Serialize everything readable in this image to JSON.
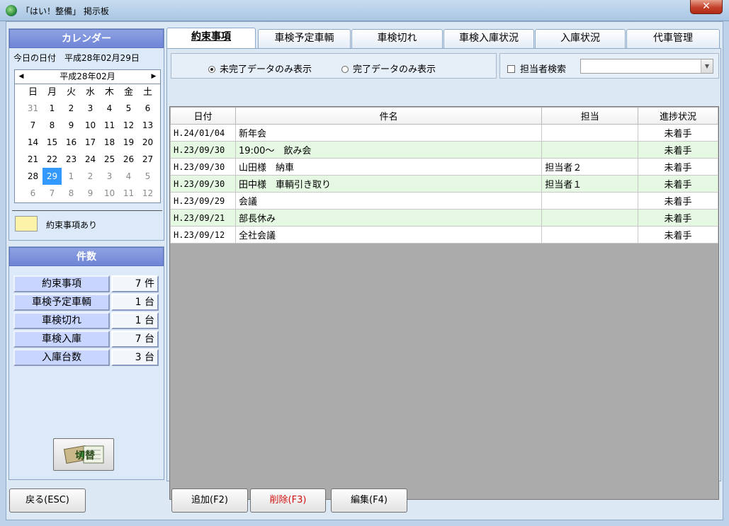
{
  "window": {
    "title": "「はい！整備」 掲示板",
    "close": "✕"
  },
  "calendar_panel": {
    "title": "カレンダー",
    "today_label": "今日の日付",
    "today_value": "平成28年02月29日",
    "month_label": "平成28年02月",
    "prev": "◀",
    "next": "▶",
    "weekdays": [
      "日",
      "月",
      "火",
      "水",
      "木",
      "金",
      "土"
    ],
    "days": [
      "31",
      "1",
      "2",
      "3",
      "4",
      "5",
      "6",
      "7",
      "8",
      "9",
      "10",
      "11",
      "12",
      "13",
      "14",
      "15",
      "16",
      "17",
      "18",
      "19",
      "20",
      "21",
      "22",
      "23",
      "24",
      "25",
      "26",
      "27",
      "28",
      "29",
      "1",
      "2",
      "3",
      "4",
      "5",
      "6",
      "7",
      "8",
      "9",
      "10",
      "11",
      "12"
    ],
    "selected_day": "29",
    "legend_text": "約束事項あり",
    "legend_color": "#fdf3a8"
  },
  "count_panel": {
    "title": "件数",
    "rows": [
      {
        "label": "約束事項",
        "value": "7 件"
      },
      {
        "label": "車検予定車輌",
        "value": "1 台"
      },
      {
        "label": "車検切れ",
        "value": "1 台"
      },
      {
        "label": "車検入庫",
        "value": "7 台"
      },
      {
        "label": "入庫台数",
        "value": "3 台"
      }
    ],
    "switch_label": "切替"
  },
  "tabs": [
    "約束事項",
    "車検予定車輌",
    "車検切れ",
    "車検入庫状況",
    "入庫状況",
    "代車管理"
  ],
  "active_tab": "約束事項",
  "filter": {
    "option_incomplete": "未完了データのみ表示",
    "option_complete": "完了データのみ表示",
    "selected": "incomplete",
    "search_checkbox": "担当者検索",
    "search_value": ""
  },
  "table": {
    "columns": [
      "日付",
      "件名",
      "担当",
      "進捗状況"
    ],
    "rows": [
      {
        "date": "H.24/01/04",
        "subject": "新年会",
        "person": "",
        "status": "未着手"
      },
      {
        "date": "H.23/09/30",
        "subject": "19:00～　飲み会",
        "person": "",
        "status": "未着手"
      },
      {
        "date": "H.23/09/30",
        "subject": "山田様　納車",
        "person": "担当者２",
        "status": "未着手"
      },
      {
        "date": "H.23/09/30",
        "subject": "田中様　車輌引き取り",
        "person": "担当者１",
        "status": "未着手"
      },
      {
        "date": "H.23/09/29",
        "subject": "会議",
        "person": "",
        "status": "未着手"
      },
      {
        "date": "H.23/09/21",
        "subject": "部長休み",
        "person": "",
        "status": "未着手"
      },
      {
        "date": "H.23/09/12",
        "subject": "全社会議",
        "person": "",
        "status": "未着手"
      }
    ]
  },
  "buttons": {
    "back": "戻る(ESC)",
    "add": "追加(F2)",
    "delete": "削除(F3)",
    "edit": "編集(F4)"
  },
  "colors": {
    "accent": "#7b90dc",
    "selected_day": "#3399ff",
    "alt_row": "#e4f8e2",
    "delete_text": "#d01010"
  }
}
